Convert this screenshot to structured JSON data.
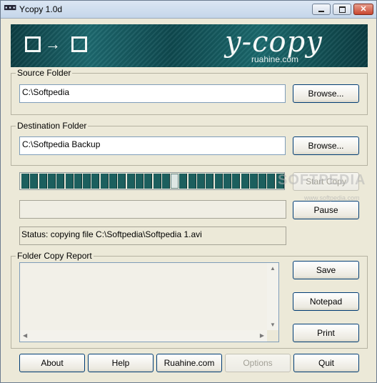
{
  "window": {
    "title": "Ycopy 1.0d",
    "app_icon": "ycopy-app-icon"
  },
  "banner": {
    "brand": "y-copy",
    "sub": "ruahine.com"
  },
  "source": {
    "label": "Source Folder",
    "value": "C:\\Softpedia",
    "browse": "Browse..."
  },
  "destination": {
    "label": "Destination Folder",
    "value": "C:\\Softpedia Backup",
    "browse": "Browse..."
  },
  "progress": {
    "segments": 30,
    "marker_index": 17
  },
  "actions": {
    "start": "Start Copy",
    "pause": "Pause"
  },
  "status": {
    "text": "Status: copying file C:\\Softpedia\\Softpedia 1.avi"
  },
  "report": {
    "label": "Folder Copy Report",
    "save": "Save",
    "notepad": "Notepad",
    "print": "Print"
  },
  "bottom": {
    "about": "About",
    "help": "Help",
    "site": "Ruahine.com",
    "options": "Options",
    "quit": "Quit"
  },
  "watermark": {
    "main": "SOFTPEDIA",
    "sub": "www.softpedia.com"
  },
  "colors": {
    "progress_fill": "#1c5f5e",
    "banner": "#1d6a70"
  }
}
